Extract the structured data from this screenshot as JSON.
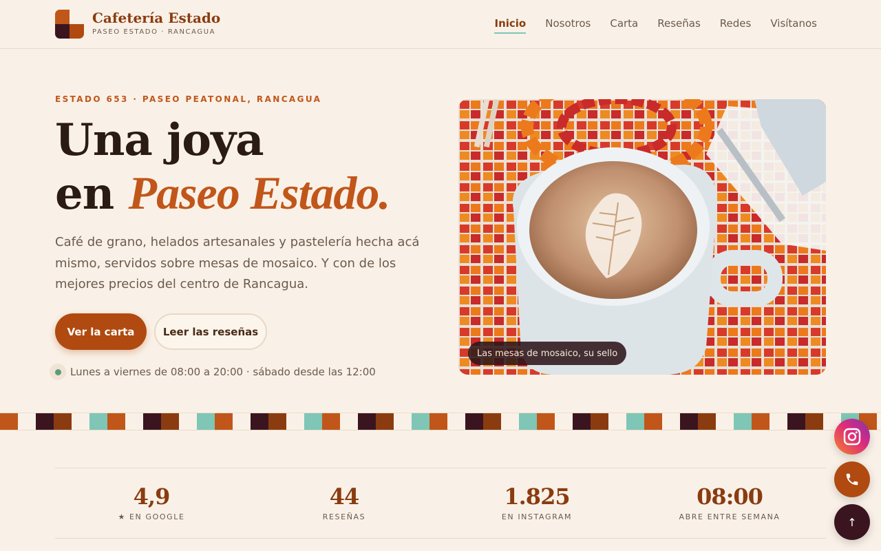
{
  "header": {
    "brand_name": "Cafetería Estado",
    "brand_sub": "PASEO ESTADO · RANCAGUA",
    "logo_colors": [
      "#c1561a",
      "#f9f1e7",
      "#3a1520",
      "#b04a10"
    ],
    "nav": [
      {
        "label": "Inicio",
        "active": true
      },
      {
        "label": "Nosotros",
        "active": false
      },
      {
        "label": "Carta",
        "active": false
      },
      {
        "label": "Reseñas",
        "active": false
      },
      {
        "label": "Redes",
        "active": false
      },
      {
        "label": "Visítanos",
        "active": false
      }
    ]
  },
  "hero": {
    "eyebrow": "ESTADO 653 · PASEO PEATONAL, RANCAGUA",
    "title_line1": "Una joya",
    "title_line2_prefix": "en ",
    "title_line2_accent": "Paseo Estado.",
    "lead": "Café de grano, helados artesanales y pastelería hecha acá mismo, servidos sobre mesas de mosaico. Y con de los mejores precios del centro de Rancagua.",
    "primary_cta": "Ver la carta",
    "secondary_cta": "Leer las reseñas",
    "hours": "Lunes a viernes de 08:00 a 20:00 · sábado desde las 12:00",
    "photo_caption": "Las mesas de mosaico, su sello"
  },
  "stats": [
    {
      "value": "4,9",
      "label": "★ EN GOOGLE"
    },
    {
      "value": "44",
      "label": "RESEÑAS"
    },
    {
      "value": "1.825",
      "label": "EN INSTAGRAM"
    },
    {
      "value": "08:00",
      "label": "ABRE ENTRE SEMANA"
    }
  ],
  "floating": {
    "instagram_icon": "instagram-icon",
    "phone_icon": "phone-icon",
    "top_label": "↑"
  },
  "colors": {
    "accent": "#c1561a",
    "accent_dark": "#8a3c10",
    "mint": "#7fc6b6",
    "plum": "#3a1520",
    "background": "#f9f1e7"
  }
}
